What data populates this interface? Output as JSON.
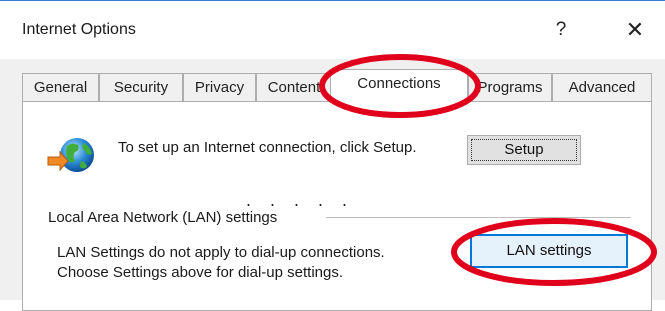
{
  "window": {
    "title": "Internet Options",
    "help_glyph": "?",
    "close_glyph": "✕"
  },
  "tabs": [
    {
      "label": "General",
      "active": false
    },
    {
      "label": "Security",
      "active": false
    },
    {
      "label": "Privacy",
      "active": false
    },
    {
      "label": "Content",
      "active": false
    },
    {
      "label": "Connections",
      "active": true
    },
    {
      "label": "Programs",
      "active": false
    },
    {
      "label": "Advanced",
      "active": false
    }
  ],
  "connections": {
    "icon": "globe-network-icon",
    "setup_text": "To set up an Internet connection, click Setup.",
    "setup_button": "Setup",
    "separator_dots": ". . . . .",
    "lan_group_label": "Local Area Network (LAN) settings",
    "lan_text_line1": "LAN Settings do not apply to dial-up connections.",
    "lan_text_line2": "Choose Settings above for dial-up settings.",
    "lan_button": "LAN settings"
  },
  "colors": {
    "annotation": "#e0001b",
    "focus_blue": "#0078d7",
    "title_accent": "#3a7bd5"
  }
}
